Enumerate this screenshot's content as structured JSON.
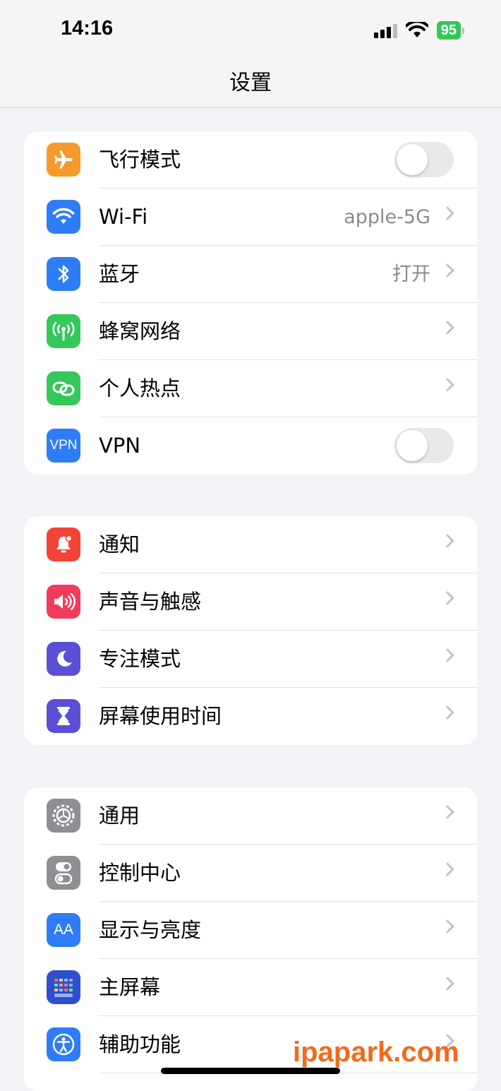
{
  "status_bar": {
    "time": "14:16",
    "battery": "95"
  },
  "nav": {
    "title": "设置"
  },
  "groups": [
    {
      "items": [
        {
          "label": "飞行模式",
          "icon": "airplane-icon",
          "color": "#f59a2d",
          "control": "toggle",
          "on": false
        },
        {
          "label": "Wi-Fi",
          "icon": "wifi-icon",
          "color": "#2f7df6",
          "value": "apple-5G"
        },
        {
          "label": "蓝牙",
          "icon": "bluetooth-icon",
          "color": "#2f7df6",
          "value": "打开"
        },
        {
          "label": "蜂窝网络",
          "icon": "cellular-icon",
          "color": "#34c759"
        },
        {
          "label": "个人热点",
          "icon": "hotspot-icon",
          "color": "#34c759"
        },
        {
          "label": "VPN",
          "icon": "vpn-icon",
          "icon_text": "VPN",
          "color": "#2f7df6",
          "control": "toggle",
          "on": false
        }
      ]
    },
    {
      "items": [
        {
          "label": "通知",
          "icon": "bell-icon",
          "color": "#f44336"
        },
        {
          "label": "声音与触感",
          "icon": "speaker-icon",
          "color": "#f23b5a"
        },
        {
          "label": "专注模式",
          "icon": "moon-icon",
          "color": "#5b4fd6"
        },
        {
          "label": "屏幕使用时间",
          "icon": "hourglass-icon",
          "color": "#5b4fd6"
        }
      ]
    },
    {
      "items": [
        {
          "label": "通用",
          "icon": "gear-icon",
          "color": "#8e8e93"
        },
        {
          "label": "控制中心",
          "icon": "switches-icon",
          "color": "#8e8e93"
        },
        {
          "label": "显示与亮度",
          "icon": "text-size-icon",
          "icon_text": "AA",
          "color": "#2f7df6"
        },
        {
          "label": "主屏幕",
          "icon": "home-screen-icon",
          "color": "#2f4fcf"
        },
        {
          "label": "辅助功能",
          "icon": "accessibility-icon",
          "color": "#2f7df6"
        }
      ]
    }
  ],
  "watermark": "ipapark.com"
}
